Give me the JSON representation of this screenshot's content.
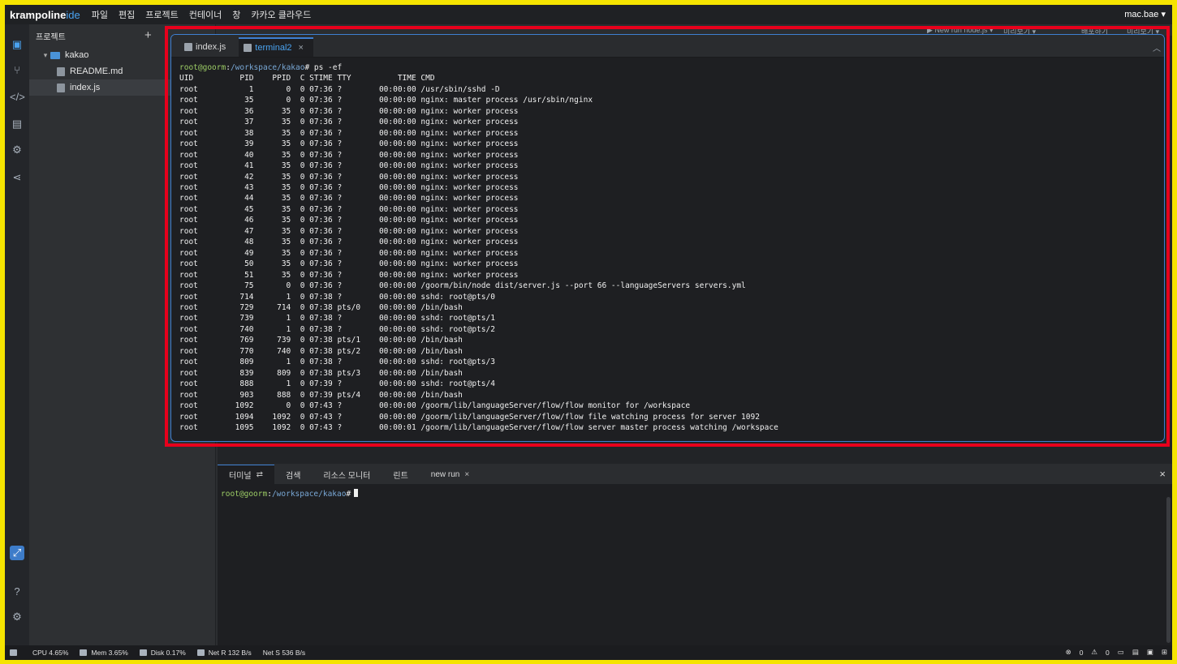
{
  "app": {
    "brand_main": "krampoline",
    "brand_suffix": "ide",
    "user": "mac.bae ▾"
  },
  "menu": [
    "파일",
    "편집",
    "프로젝트",
    "컨테이너",
    "창",
    "카카오 클라우드"
  ],
  "toolbar": {
    "run_label": "▶ New run node.js ▾",
    "preview_label": "미리보기 ▾",
    "deploy_label": "배포하기",
    "preview2_label": "미리보기 ▾"
  },
  "sidebar": {
    "title": "프로젝트",
    "add_icon": "+",
    "folder": "kakao",
    "files": [
      "README.md",
      "index.js"
    ]
  },
  "editor_tabs": [
    {
      "label": "index.js",
      "icon": "file-icon"
    },
    {
      "label": "terminal2",
      "icon": "terminal-icon",
      "close": "×"
    }
  ],
  "terminal": {
    "prompt_user": "root@goorm",
    "prompt_sep": ":",
    "prompt_path": "/workspace/kakao",
    "command": "# ps -ef",
    "lines": [
      "UID          PID    PPID  C STIME TTY          TIME CMD",
      "root           1       0  0 07:36 ?        00:00:00 /usr/sbin/sshd -D",
      "root          35       0  0 07:36 ?        00:00:00 nginx: master process /usr/sbin/nginx",
      "root          36      35  0 07:36 ?        00:00:00 nginx: worker process",
      "root          37      35  0 07:36 ?        00:00:00 nginx: worker process",
      "root          38      35  0 07:36 ?        00:00:00 nginx: worker process",
      "root          39      35  0 07:36 ?        00:00:00 nginx: worker process",
      "root          40      35  0 07:36 ?        00:00:00 nginx: worker process",
      "root          41      35  0 07:36 ?        00:00:00 nginx: worker process",
      "root          42      35  0 07:36 ?        00:00:00 nginx: worker process",
      "root          43      35  0 07:36 ?        00:00:00 nginx: worker process",
      "root          44      35  0 07:36 ?        00:00:00 nginx: worker process",
      "root          45      35  0 07:36 ?        00:00:00 nginx: worker process",
      "root          46      35  0 07:36 ?        00:00:00 nginx: worker process",
      "root          47      35  0 07:36 ?        00:00:00 nginx: worker process",
      "root          48      35  0 07:36 ?        00:00:00 nginx: worker process",
      "root          49      35  0 07:36 ?        00:00:00 nginx: worker process",
      "root          50      35  0 07:36 ?        00:00:00 nginx: worker process",
      "root          51      35  0 07:36 ?        00:00:00 nginx: worker process",
      "root          75       0  0 07:36 ?        00:00:00 /goorm/bin/node dist/server.js --port 66 --languageServers servers.yml",
      "root         714       1  0 07:38 ?        00:00:00 sshd: root@pts/0",
      "root         729     714  0 07:38 pts/0    00:00:00 /bin/bash",
      "root         739       1  0 07:38 ?        00:00:00 sshd: root@pts/1",
      "root         740       1  0 07:38 ?        00:00:00 sshd: root@pts/2",
      "root         769     739  0 07:38 pts/1    00:00:00 /bin/bash",
      "root         770     740  0 07:38 pts/2    00:00:00 /bin/bash",
      "root         809       1  0 07:38 ?        00:00:00 sshd: root@pts/3",
      "root         839     809  0 07:38 pts/3    00:00:00 /bin/bash",
      "root         888       1  0 07:39 ?        00:00:00 sshd: root@pts/4",
      "root         903     888  0 07:39 pts/4    00:00:00 /bin/bash",
      "root        1092       0  0 07:43 ?        00:00:00 /goorm/lib/languageServer/flow/flow monitor for /workspace",
      "root        1094    1092  0 07:43 ?        00:00:00 /goorm/lib/languageServer/flow/flow file watching process for server 1092",
      "root        1095    1092  0 07:43 ?        00:00:01 /goorm/lib/languageServer/flow/flow server master process watching /workspace"
    ]
  },
  "bottom_panel": {
    "tabs": [
      {
        "label": "터미널",
        "icon": "⇄"
      },
      {
        "label": "검색"
      },
      {
        "label": "리소스 모니터"
      },
      {
        "label": "린트"
      },
      {
        "label": "new run",
        "close": "×"
      }
    ],
    "close_icon": "×",
    "prompt_user": "root@goorm",
    "prompt_sep": ":",
    "prompt_path": "/workspace/kakao",
    "prompt_end": "#"
  },
  "statusbar": {
    "cpu": "CPU 4.65%",
    "mem": "Mem 3.65%",
    "disk": "Disk 0.17%",
    "net_r": "Net R 132 B/s",
    "net_s": "Net S 536 B/s",
    "errors": "0",
    "warnings": "0"
  }
}
